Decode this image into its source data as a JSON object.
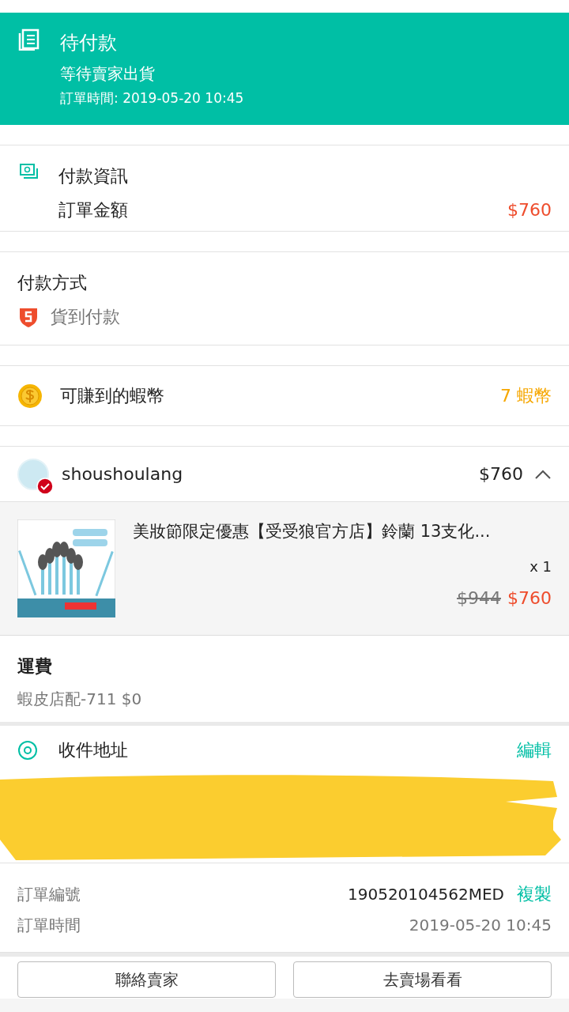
{
  "status_banner": {
    "title": "待付款",
    "subtitle": "等待賣家出貨",
    "order_time": "訂單時間: 2019-05-20 10:45"
  },
  "payment_info": {
    "title": "付款資訊",
    "label": "訂單金額",
    "amount": "$760"
  },
  "payment_method": {
    "title": "付款方式",
    "method": "貨到付款"
  },
  "coins": {
    "label": "可賺到的蝦幣",
    "value": "7 蝦幣"
  },
  "shop": {
    "name": "shoushoulang",
    "verified": true,
    "total": "$760",
    "expanded": true
  },
  "product": {
    "kind": "picture",
    "title": "美妝節限定優惠【受受狼官方店】鈴蘭 13支化...",
    "quantity": "x 1",
    "original_price": "$944",
    "price": "$760"
  },
  "shipping": {
    "title": "運費",
    "detail": "蝦皮店配-711 $0"
  },
  "address": {
    "title": "收件地址",
    "edit": "編輯"
  },
  "order": {
    "number_label": "訂單編號",
    "number": "190520104562MED",
    "copy": "複製",
    "time_label": "訂單時間",
    "time": "2019-05-20 10:45"
  },
  "buttons": [
    "聯絡賣家",
    "去賣場看看"
  ]
}
